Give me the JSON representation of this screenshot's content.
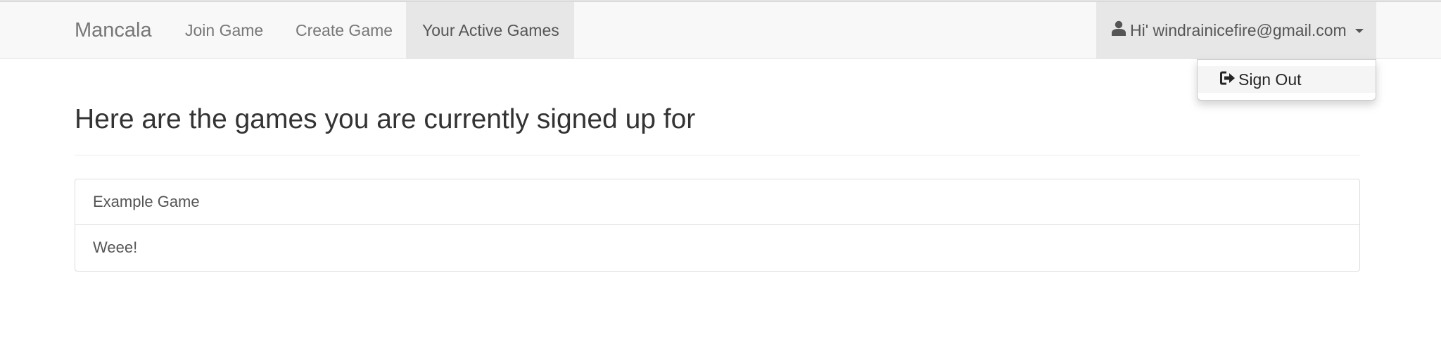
{
  "navbar": {
    "brand": "Mancala",
    "links": [
      {
        "label": "Join Game"
      },
      {
        "label": "Create Game"
      },
      {
        "label": "Your Active Games",
        "active": true
      }
    ],
    "user_menu": {
      "greeting": "Hi' windrainicefire@gmail.com",
      "icon": "user-icon",
      "expanded": true
    }
  },
  "dropdown": {
    "items": [
      {
        "label": "Sign Out",
        "icon": "sign-out-icon"
      }
    ]
  },
  "main": {
    "heading": "Here are the games you are currently signed up for",
    "games": [
      {
        "name": "Example Game"
      },
      {
        "name": "Weee!"
      }
    ]
  },
  "colors": {
    "navbar_bg": "#f8f8f8",
    "active_bg": "#e7e7e7",
    "link_text": "#777777",
    "active_text": "#555555",
    "heading_text": "#333333",
    "border": "#dddddd"
  }
}
